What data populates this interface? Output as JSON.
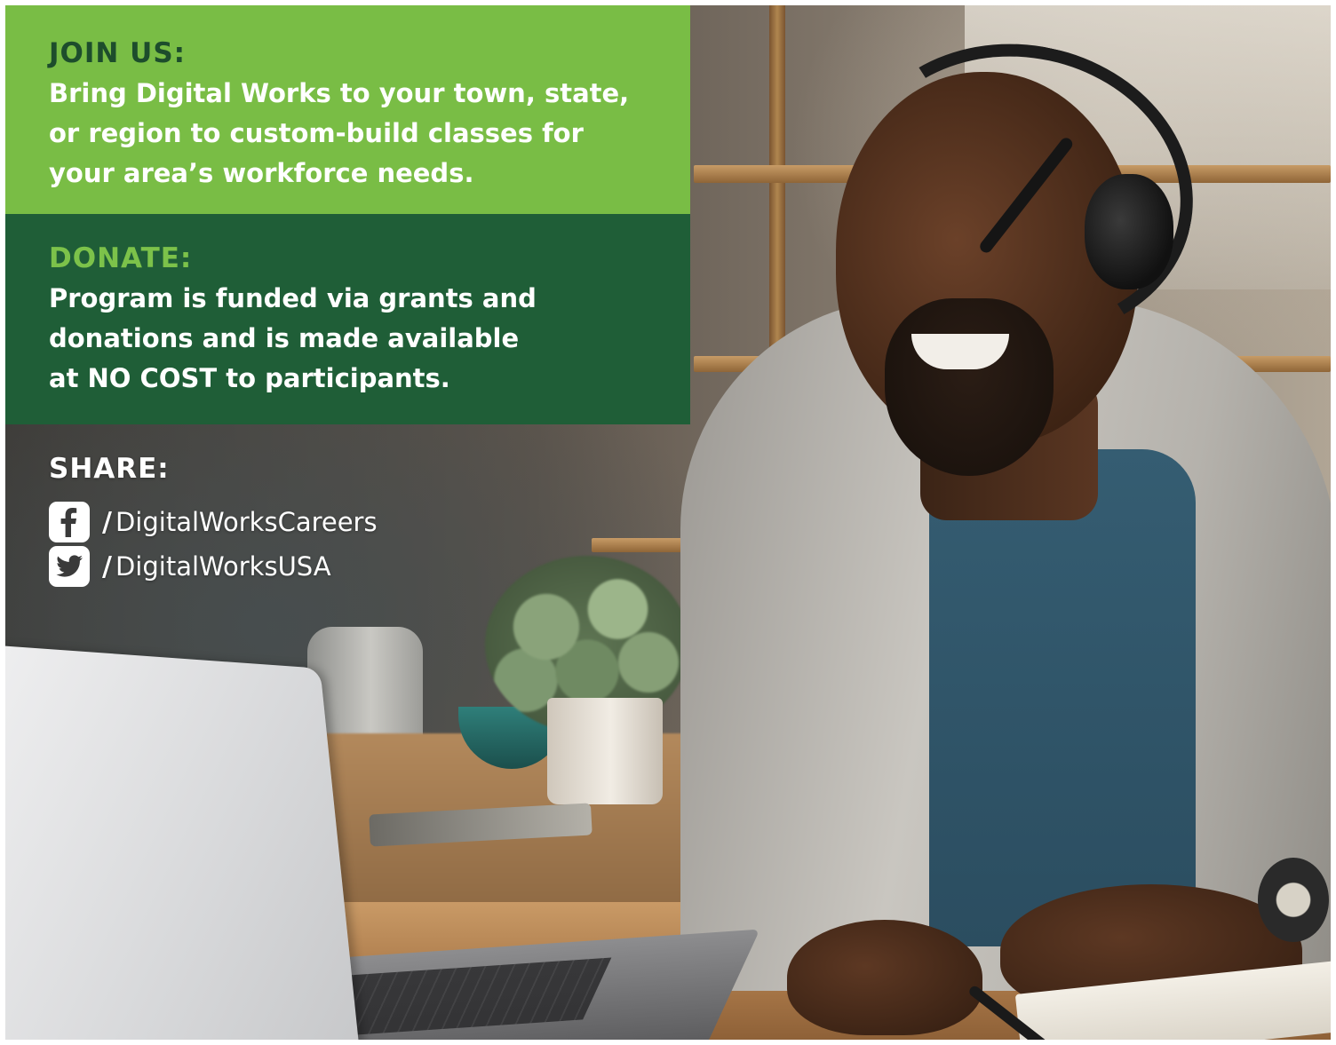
{
  "join": {
    "heading": "JOIN US:",
    "lines": [
      "Bring Digital Works to your town, state,",
      "or region to custom-build classes for",
      "your area’s workforce needs."
    ]
  },
  "donate": {
    "heading": "DONATE:",
    "lines": [
      "Program is funded via grants and",
      "donations and is made available",
      "at NO COST to participants."
    ]
  },
  "share": {
    "heading": "SHARE:",
    "links": [
      {
        "icon": "facebook-icon",
        "separator": "/",
        "handle": "DigitalWorksCareers"
      },
      {
        "icon": "twitter-icon",
        "separator": "/",
        "handle": "DigitalWorksUSA"
      }
    ]
  },
  "colors": {
    "join_panel": "#79bd45",
    "join_heading": "#1d4d2c",
    "donate_panel": "#1f5e37",
    "donate_heading": "#7cc24a",
    "body_text": "#ffffff"
  }
}
